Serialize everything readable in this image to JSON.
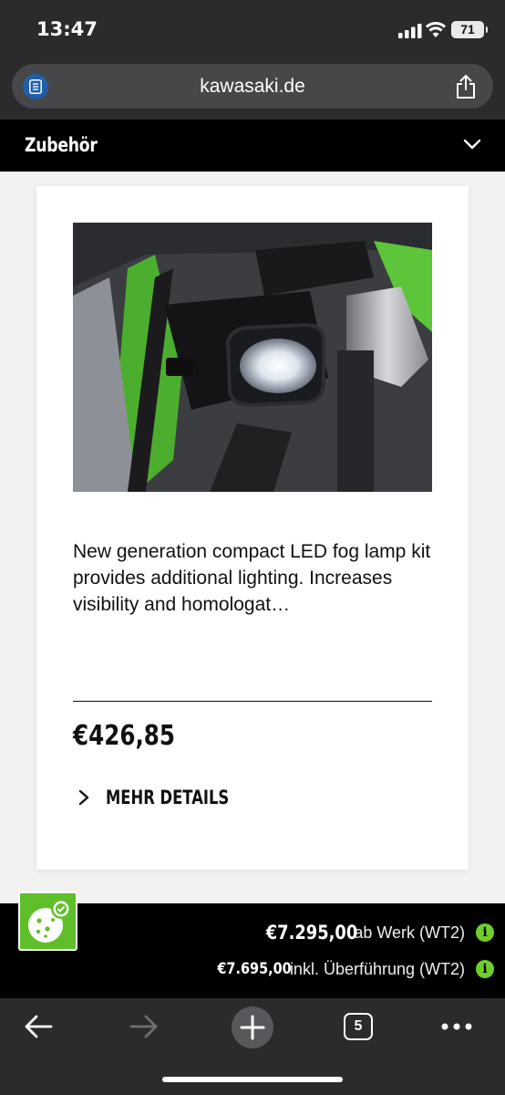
{
  "status_bar": {
    "time": "13:47",
    "battery": "71"
  },
  "browser": {
    "url": "kawasaki.de"
  },
  "accordion": {
    "title": "Zubehör"
  },
  "product": {
    "description": "New generation compact LED fog lamp kit provides additional lighting. Increases visibility and homologat…",
    "price": "€426,85",
    "more_details_label": "MEHR DETAILS"
  },
  "price_bar": {
    "line1_price": "€7.295,00",
    "line1_text": "ab Werk (WT2)",
    "line2_price": "€7.695,00",
    "line2_text": "inkl. Überführung (WT2)"
  },
  "toolbar": {
    "tab_count": "5"
  },
  "colors": {
    "accent": "#6fcf2a",
    "bar": "#000000",
    "chrome": "#2b2b2d"
  }
}
